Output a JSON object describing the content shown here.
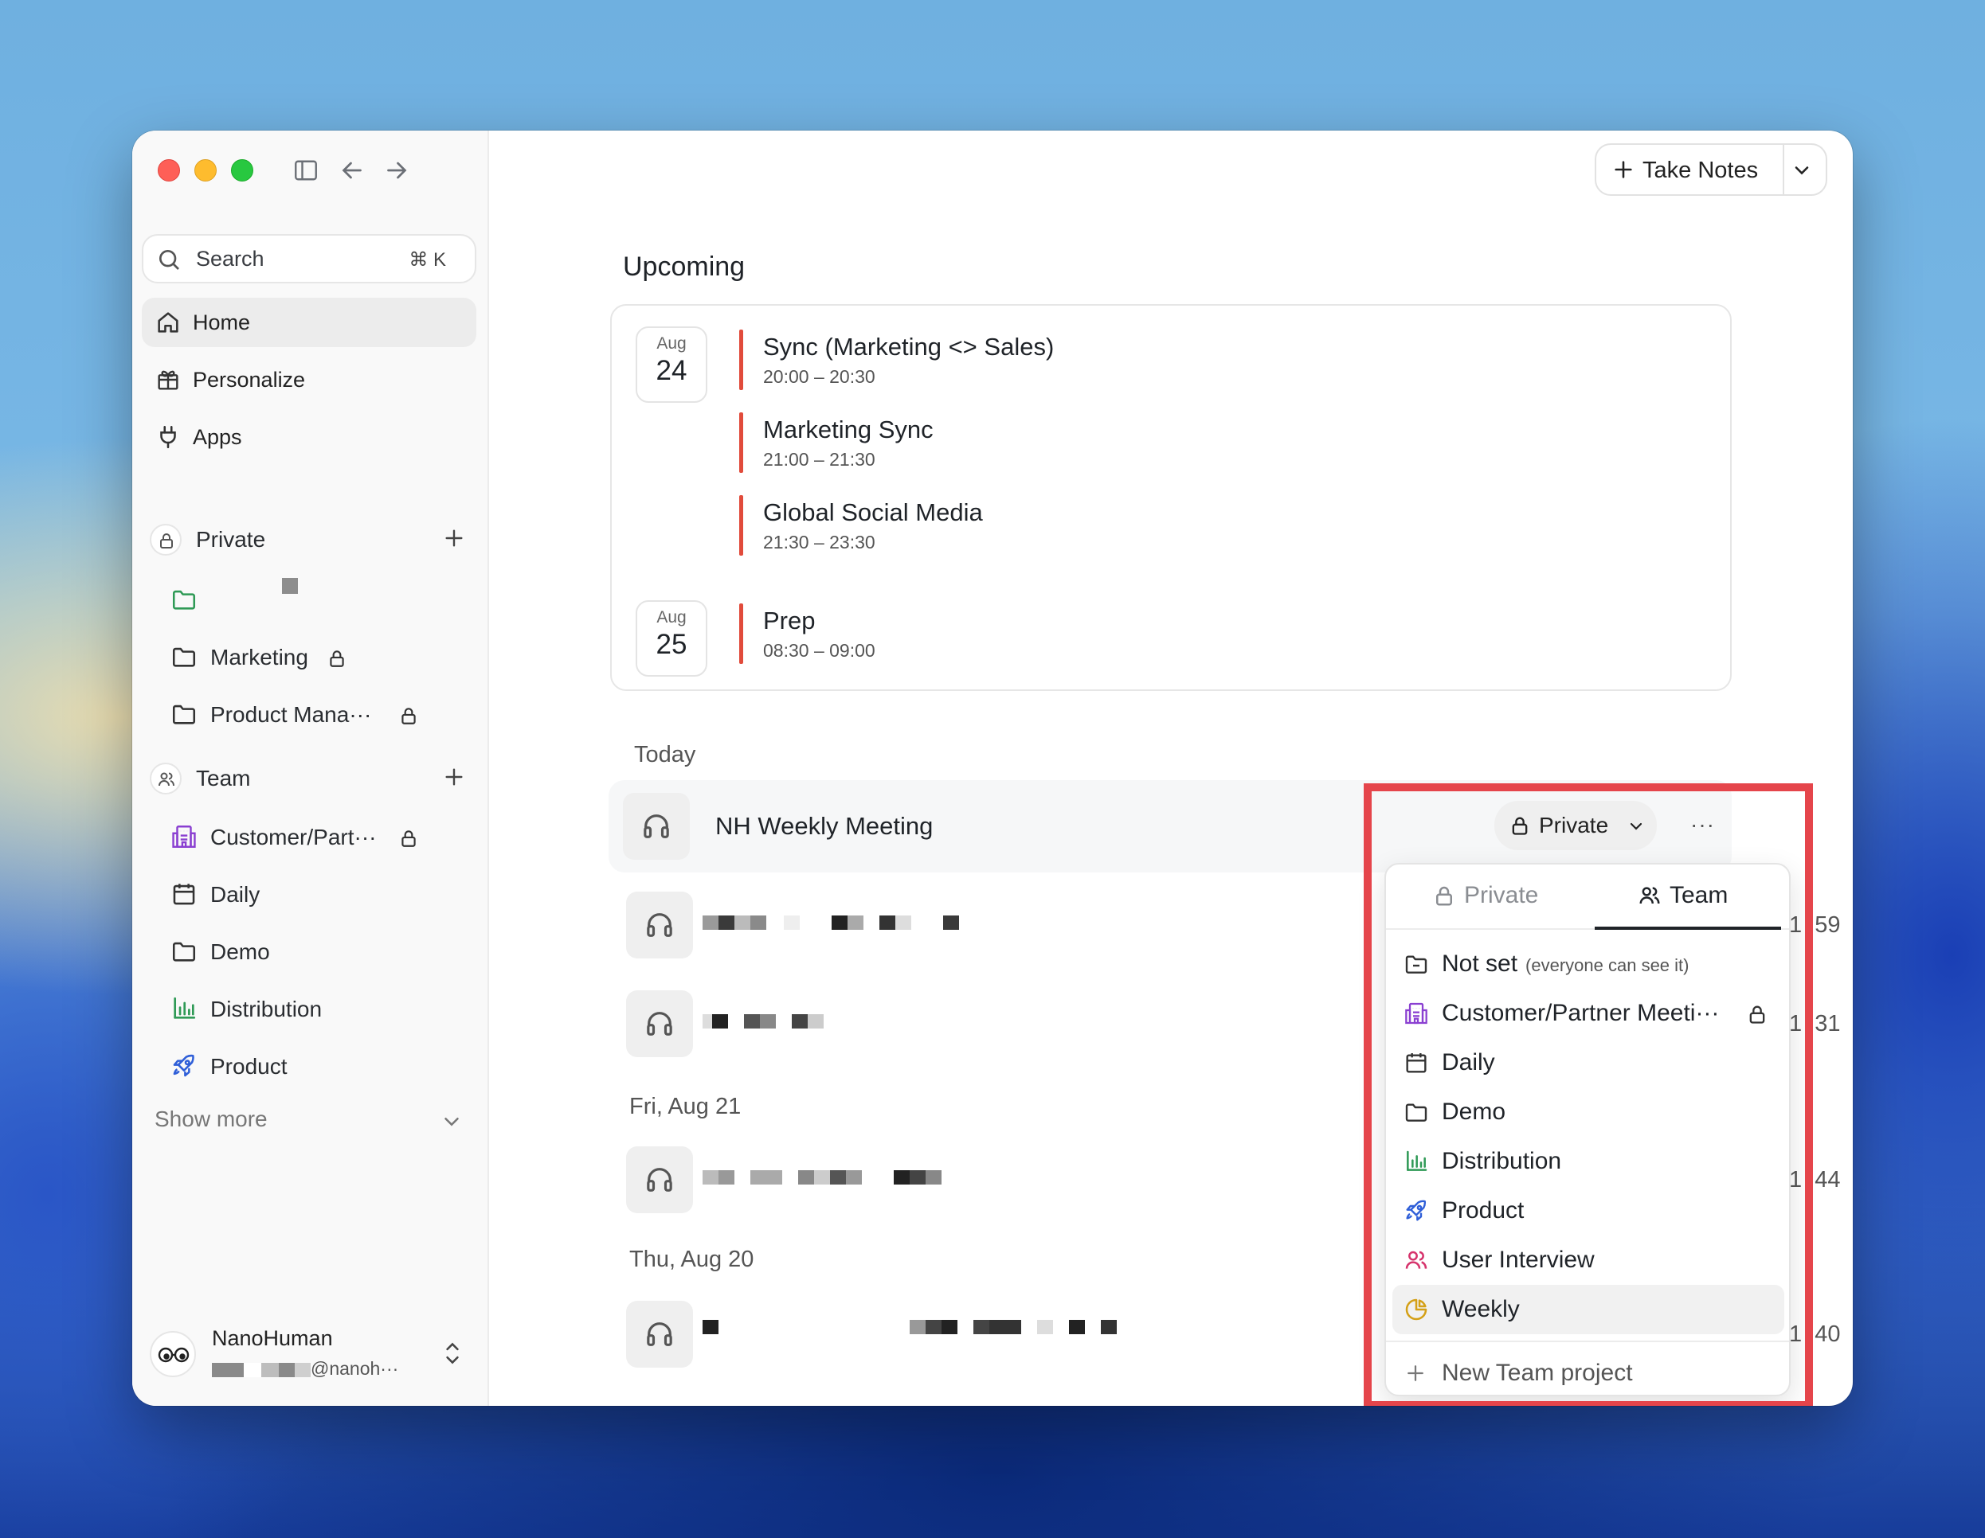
{
  "sidebar": {
    "search": {
      "label": "Search",
      "shortcut": "⌘ K"
    },
    "nav": [
      {
        "label": "Home",
        "icon": "home-icon",
        "active": true
      },
      {
        "label": "Personalize",
        "icon": "gift-icon",
        "active": false
      },
      {
        "label": "Apps",
        "icon": "plug-icon",
        "active": false
      }
    ],
    "private_section": {
      "label": "Private",
      "items": [
        {
          "label": "",
          "icon": "folder-icon"
        },
        {
          "label": "Marketing",
          "icon": "folder-icon",
          "locked": true
        },
        {
          "label": "Product Mana···",
          "icon": "folder-icon",
          "locked": true
        }
      ]
    },
    "team_section": {
      "label": "Team",
      "items": [
        {
          "label": "Customer/Part···",
          "icon": "building-icon",
          "locked": true
        },
        {
          "label": "Daily",
          "icon": "calendar-icon"
        },
        {
          "label": "Demo",
          "icon": "folder-icon"
        },
        {
          "label": "Distribution",
          "icon": "bar-chart-icon"
        },
        {
          "label": "Product",
          "icon": "rocket-icon"
        }
      ]
    },
    "show_more": "Show more",
    "user": {
      "name": "NanoHuman",
      "email_suffix": "@nanoh···"
    }
  },
  "header": {
    "take_notes": "Take Notes"
  },
  "upcoming": {
    "title": "Upcoming",
    "days": [
      {
        "month": "Aug",
        "day": "24",
        "events": [
          {
            "title": "Sync (Marketing <> Sales)",
            "time": "20:00 – 20:30"
          },
          {
            "title": "Marketing Sync",
            "time": "21:00 – 21:30"
          },
          {
            "title": "Global Social Media",
            "time": "21:30 – 23:30"
          }
        ]
      },
      {
        "month": "Aug",
        "day": "25",
        "events": [
          {
            "title": "Prep",
            "time": "08:30 – 09:00"
          }
        ]
      }
    ]
  },
  "meetings": {
    "today_label": "Today",
    "featured": {
      "title": "NH Weekly Meeting",
      "visibility": "Private"
    },
    "times": [
      "1 :59",
      "1 :31",
      "1 :44",
      "1 :40"
    ],
    "fri_label": "Fri, Aug 21",
    "thu_label": "Thu, Aug 20"
  },
  "visibility_menu": {
    "tabs": {
      "private": "Private",
      "team": "Team"
    },
    "active_tab": "Team",
    "items": [
      {
        "label": "Not set",
        "sub": "(everyone can see it)",
        "icon": "folder-minus-icon"
      },
      {
        "label": "Customer/Partner Meeti···",
        "icon": "building-icon",
        "locked": true
      },
      {
        "label": "Daily",
        "icon": "calendar-icon"
      },
      {
        "label": "Demo",
        "icon": "folder-icon"
      },
      {
        "label": "Distribution",
        "icon": "bar-chart-icon"
      },
      {
        "label": "Product",
        "icon": "rocket-icon"
      },
      {
        "label": "User Interview",
        "icon": "users-icon"
      },
      {
        "label": "Weekly",
        "icon": "pie-chart-icon",
        "selected": true
      }
    ],
    "new_project": "New Team project"
  },
  "colors": {
    "event_bar": "#e14b3b",
    "highlight_box": "#e5454b",
    "building": "#8a3fd1",
    "distribution": "#2f9a56",
    "rocket": "#2f5fd8",
    "users": "#d6336c",
    "weekly": "#d4a017"
  }
}
